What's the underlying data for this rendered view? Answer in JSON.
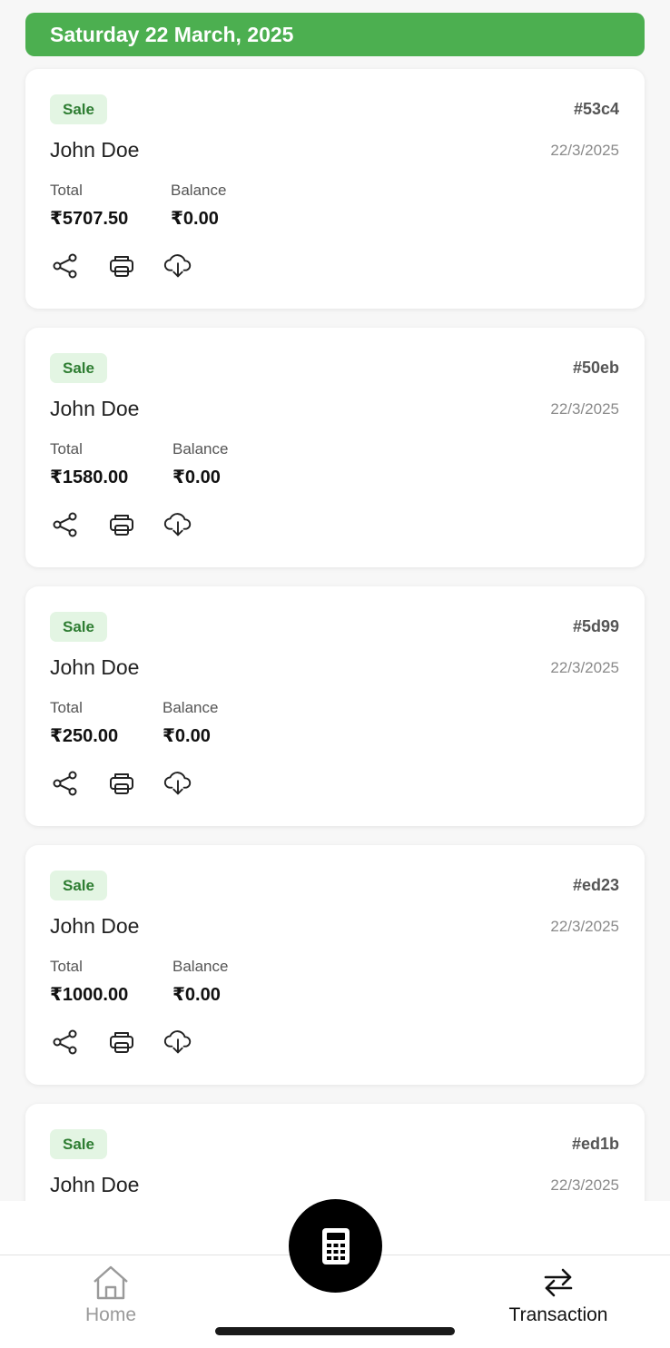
{
  "header": {
    "date_label": "Saturday 22 March, 2025"
  },
  "labels": {
    "total": "Total",
    "balance": "Balance"
  },
  "transactions": [
    {
      "type": "Sale",
      "id": "#53c4",
      "customer": "John Doe",
      "date": "22/3/2025",
      "total": "₹5707.50",
      "balance": "₹0.00"
    },
    {
      "type": "Sale",
      "id": "#50eb",
      "customer": "John Doe",
      "date": "22/3/2025",
      "total": "₹1580.00",
      "balance": "₹0.00"
    },
    {
      "type": "Sale",
      "id": "#5d99",
      "customer": "John Doe",
      "date": "22/3/2025",
      "total": "₹250.00",
      "balance": "₹0.00"
    },
    {
      "type": "Sale",
      "id": "#ed23",
      "customer": "John Doe",
      "date": "22/3/2025",
      "total": "₹1000.00",
      "balance": "₹0.00"
    },
    {
      "type": "Sale",
      "id": "#ed1b",
      "customer": "John Doe",
      "date": "22/3/2025"
    }
  ],
  "actions": [
    "share-icon",
    "printer-icon",
    "cloud-download-icon"
  ],
  "nav": {
    "home_label": "Home",
    "transaction_label": "Transaction",
    "fab_icon": "calculator-icon"
  },
  "colors": {
    "header_bg": "#4caf50",
    "badge_bg": "#e3f5e3",
    "badge_text": "#2e7d32",
    "fab_bg": "#000000"
  }
}
